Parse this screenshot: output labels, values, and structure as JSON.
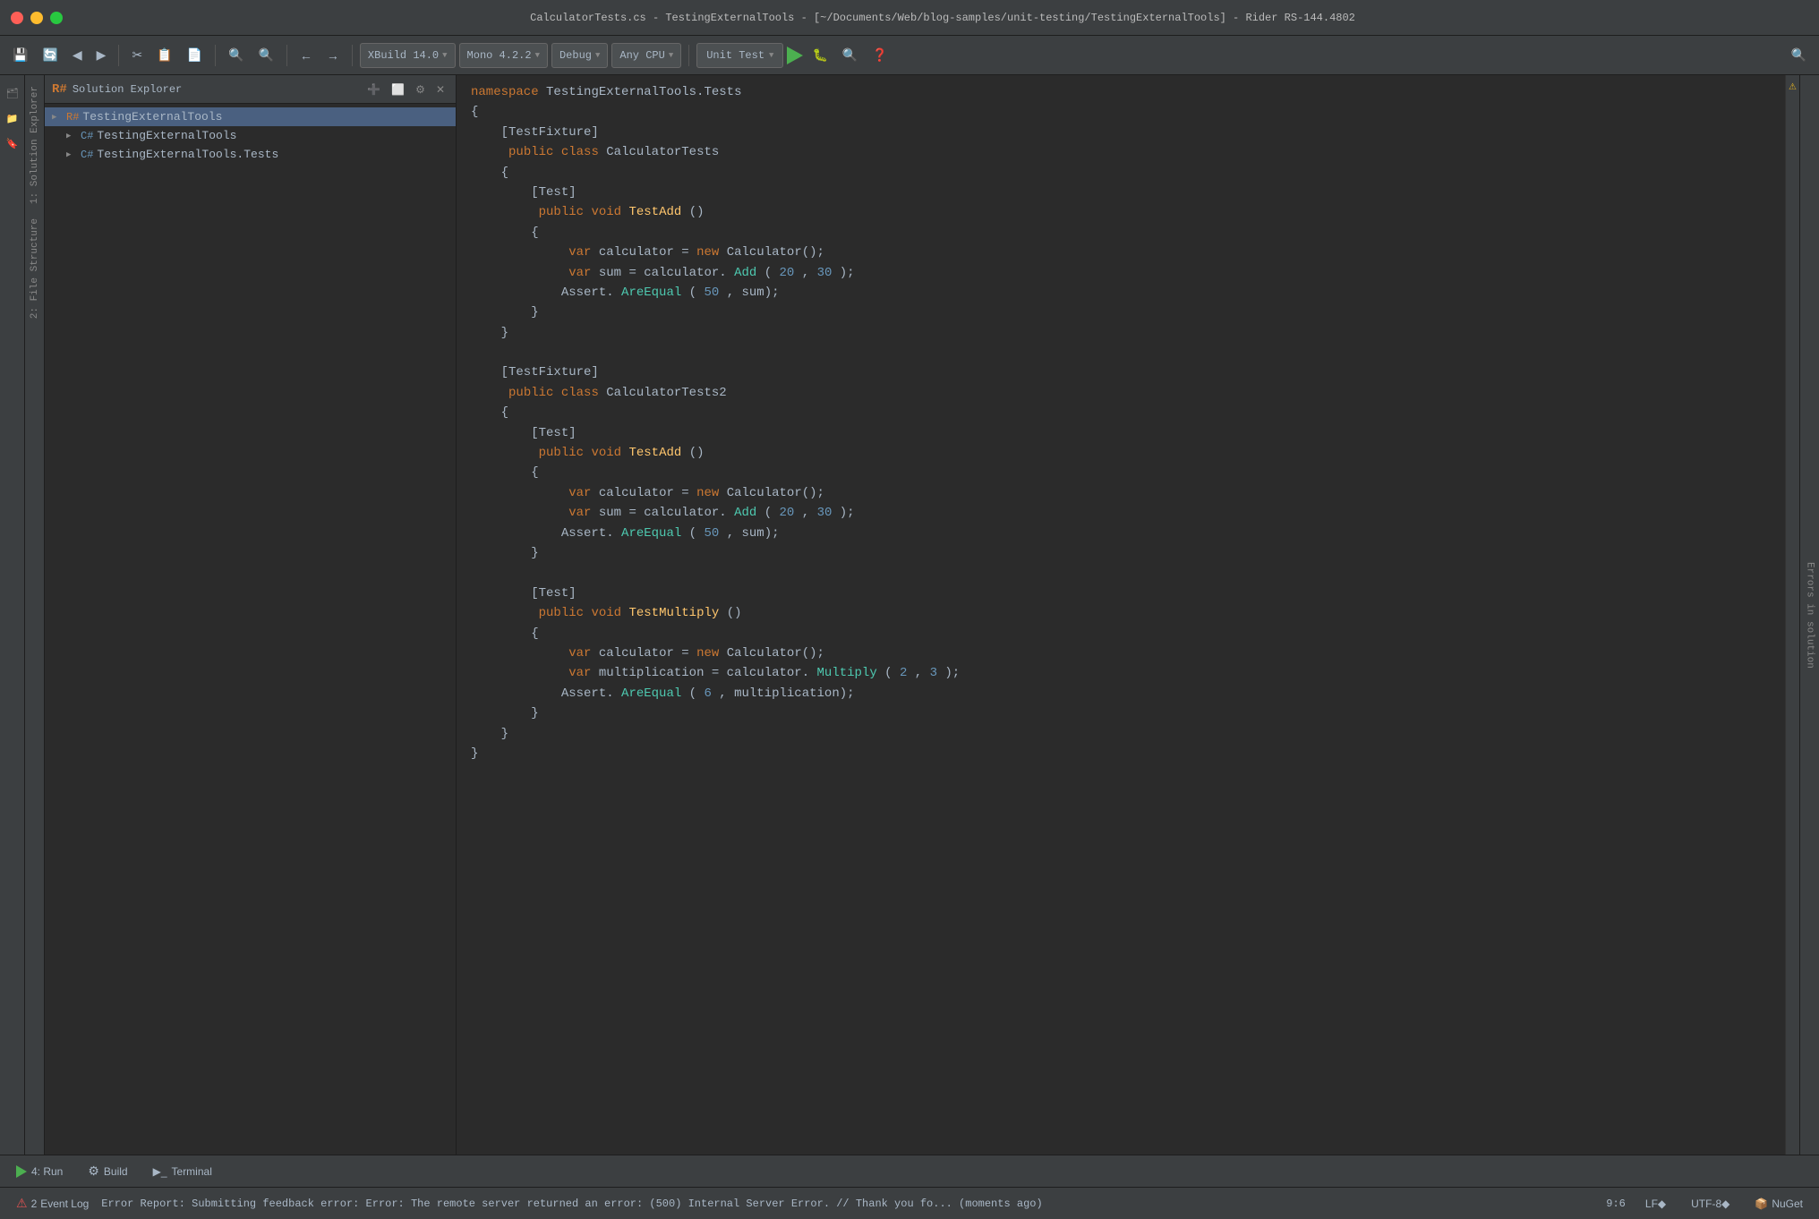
{
  "titlebar": {
    "title": "CalculatorTests.cs - TestingExternalTools - [~/Documents/Web/blog-samples/unit-testing/TestingExternalTools] - Rider RS-144.4802"
  },
  "toolbar": {
    "build_label": "XBuild 14.0",
    "mono_label": "Mono 4.2.2",
    "debug_label": "Debug",
    "cpu_label": "Any CPU",
    "unit_test_label": "Unit Test",
    "run_label": "▶"
  },
  "solution_explorer": {
    "title": "Solution Explorer",
    "root_item": "TestingExternalTools",
    "items": [
      {
        "label": "TestingExternalTools",
        "indent": 1
      },
      {
        "label": "TestingExternalTools.Tests",
        "indent": 1
      }
    ]
  },
  "vertical_tabs": {
    "tab1": "1: Solution Explorer",
    "tab2": "2: File Structure"
  },
  "code": {
    "lines": [
      {
        "num": "",
        "text": "namespace TestingExternalTools.Tests"
      },
      {
        "num": "",
        "text": "{"
      },
      {
        "num": "",
        "text": "    [TestFixture]"
      },
      {
        "num": "",
        "text": "    public class CalculatorTests"
      },
      {
        "num": "",
        "text": "    {"
      },
      {
        "num": "",
        "text": "        [Test]"
      },
      {
        "num": "",
        "text": "        public void TestAdd()"
      },
      {
        "num": "",
        "text": "        {"
      },
      {
        "num": "",
        "text": "            var calculator = new Calculator();"
      },
      {
        "num": "",
        "text": "            var sum = calculator.Add(20, 30);"
      },
      {
        "num": "",
        "text": "            Assert.AreEqual(50, sum);"
      },
      {
        "num": "",
        "text": "        }"
      },
      {
        "num": "",
        "text": "    }"
      },
      {
        "num": "",
        "text": ""
      },
      {
        "num": "",
        "text": "    [TestFixture]"
      },
      {
        "num": "",
        "text": "    public class CalculatorTests2"
      },
      {
        "num": "",
        "text": "    {"
      },
      {
        "num": "",
        "text": "        [Test]"
      },
      {
        "num": "",
        "text": "        public void TestAdd()"
      },
      {
        "num": "",
        "text": "        {"
      },
      {
        "num": "",
        "text": "            var calculator = new Calculator();"
      },
      {
        "num": "",
        "text": "            var sum = calculator.Add(20, 30);"
      },
      {
        "num": "",
        "text": "            Assert.AreEqual(50, sum);"
      },
      {
        "num": "",
        "text": "        }"
      },
      {
        "num": "",
        "text": ""
      },
      {
        "num": "",
        "text": "        [Test]"
      },
      {
        "num": "",
        "text": "        public void TestMultiply()"
      },
      {
        "num": "",
        "text": "        {"
      },
      {
        "num": "",
        "text": "            var calculator = new Calculator();"
      },
      {
        "num": "",
        "text": "            var multiplication = calculator.Multiply(2, 3);"
      },
      {
        "num": "",
        "text": "            Assert.AreEqual(6, multiplication);"
      },
      {
        "num": "",
        "text": "        }"
      },
      {
        "num": "",
        "text": "    }"
      },
      {
        "num": "",
        "text": "}"
      }
    ]
  },
  "bottom_toolbar": {
    "run_label": "4: Run",
    "build_label": "Build",
    "terminal_label": "Terminal"
  },
  "statusbar": {
    "error_count": "2",
    "error_text": "Error Report: Submitting feedback error: Error: The remote server returned an error: (500) Internal Server Error. // Thank you fo... (moments ago)",
    "position": "9:6",
    "line_feed": "LF◆",
    "encoding": "UTF-8◆",
    "event_log_label": "Event Log",
    "nuget_label": "NuGet"
  },
  "colors": {
    "keyword": "#cc7832",
    "method": "#ffc66d",
    "cyan_type": "#4ec9b0",
    "string": "#6a8759",
    "number": "#6897bb",
    "comment": "#808080",
    "plain": "#a9b7c6",
    "accent_green": "#4caf50",
    "error_red": "#e05252",
    "warning_yellow": "#e6b422"
  }
}
